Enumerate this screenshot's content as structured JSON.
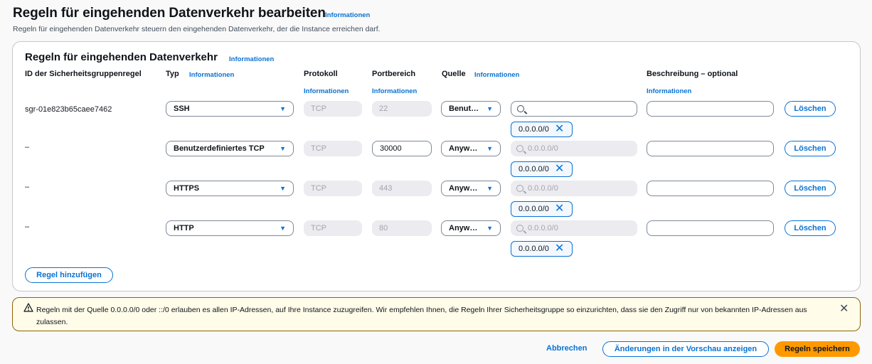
{
  "page": {
    "title": "Regeln für eingehenden Datenverkehr bearbeiten",
    "title_info": "Informationen",
    "subtitle": "Regeln für eingehenden Datenverkehr steuern den eingehenden Datenverkehr, der die Instance erreichen darf."
  },
  "panel": {
    "title": "Regeln für eingehenden Datenverkehr",
    "title_info": "Informationen",
    "columns": {
      "id": "ID der Sicherheitsgruppenregel",
      "type": "Typ",
      "type_info": "Informationen",
      "protocol": "Protokoll",
      "protocol_info": "Informationen",
      "port": "Portbereich",
      "port_info": "Informationen",
      "source": "Quelle",
      "source_info": "Informationen",
      "description": "Beschreibung – optional",
      "description_info": "Informationen"
    },
    "rows": [
      {
        "id": "sgr-01e823b65caee7462",
        "type": "SSH",
        "protocol": "TCP",
        "port": "22",
        "source": "Benut…",
        "search_placeholder": "",
        "token": "0.0.0.0/0",
        "delete": "Löschen"
      },
      {
        "id": "–",
        "type": "Benutzerdefiniertes TCP",
        "protocol": "TCP",
        "port": "30000",
        "source": "Anyw…",
        "search_placeholder": "0.0.0.0/0",
        "token": "0.0.0.0/0",
        "delete": "Löschen"
      },
      {
        "id": "–",
        "type": "HTTPS",
        "protocol": "TCP",
        "port": "443",
        "source": "Anyw…",
        "search_placeholder": "0.0.0.0/0",
        "token": "0.0.0.0/0",
        "delete": "Löschen"
      },
      {
        "id": "–",
        "type": "HTTP",
        "protocol": "TCP",
        "port": "80",
        "source": "Anyw…",
        "search_placeholder": "0.0.0.0/0",
        "token": "0.0.0.0/0",
        "delete": "Löschen"
      }
    ],
    "add_rule": "Regel hinzufügen"
  },
  "warning": {
    "text": "Regeln mit der Quelle 0.0.0.0/0 oder ::/0 erlauben es allen IP-Adressen, auf Ihre Instance zuzugreifen. Wir empfehlen Ihnen, die Regeln Ihrer Sicherheitsgruppe so einzurichten, dass sie den Zugriff nur von bekannten IP-Adressen aus zulassen."
  },
  "footer": {
    "cancel": "Abbrechen",
    "preview": "Änderungen in der Vorschau anzeigen",
    "save": "Regeln speichern"
  },
  "colors": {
    "link": "#0972d3",
    "primary": "#ff9900",
    "warning_border": "#8d6605"
  }
}
